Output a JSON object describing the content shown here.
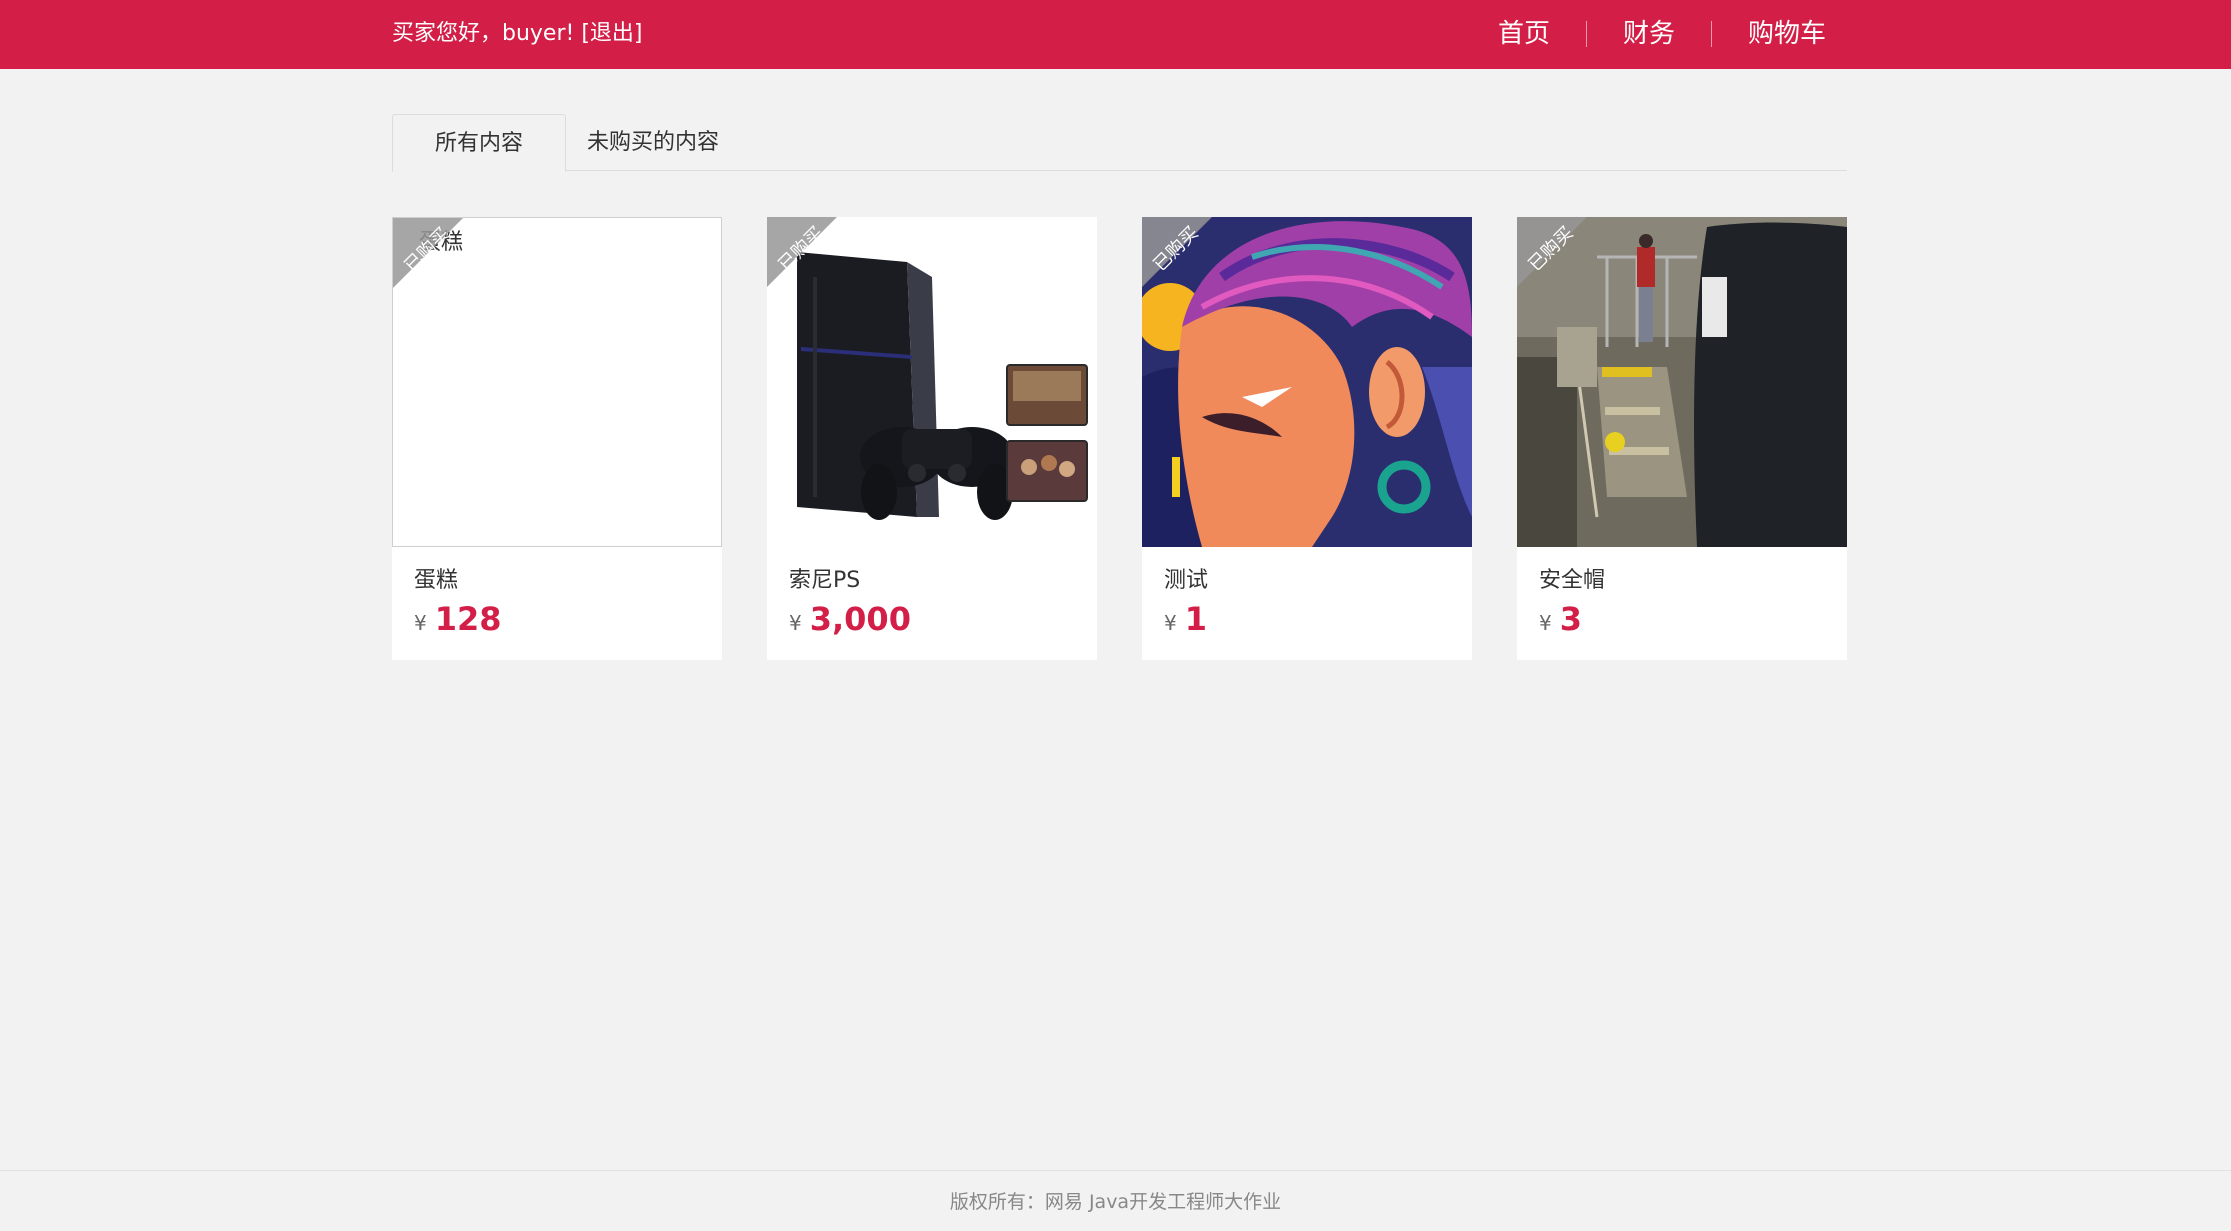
{
  "header": {
    "greeting": "买家您好，buyer!",
    "logout": "[退出]",
    "nav": [
      "首页",
      "财务",
      "购物车"
    ]
  },
  "tabs": [
    "所有内容",
    "未购买的内容"
  ],
  "products": [
    {
      "name": "蛋糕",
      "currency": "¥",
      "price": "128",
      "badge": "已购买",
      "image_alt": "蛋糕",
      "image": "broken"
    },
    {
      "name": "索尼PS",
      "currency": "¥",
      "price": "3,000",
      "badge": "已购买",
      "image": "playstation"
    },
    {
      "name": "测试",
      "currency": "¥",
      "price": "1",
      "badge": "已购买",
      "image": "illustration"
    },
    {
      "name": "安全帽",
      "currency": "¥",
      "price": "3",
      "badge": "已购买",
      "image": "cctv"
    }
  ],
  "footer": {
    "copyright": "版权所有：网易  Java开发工程师大作业"
  },
  "colors": {
    "brand": "#d31f47",
    "background": "#f2f2f2"
  }
}
